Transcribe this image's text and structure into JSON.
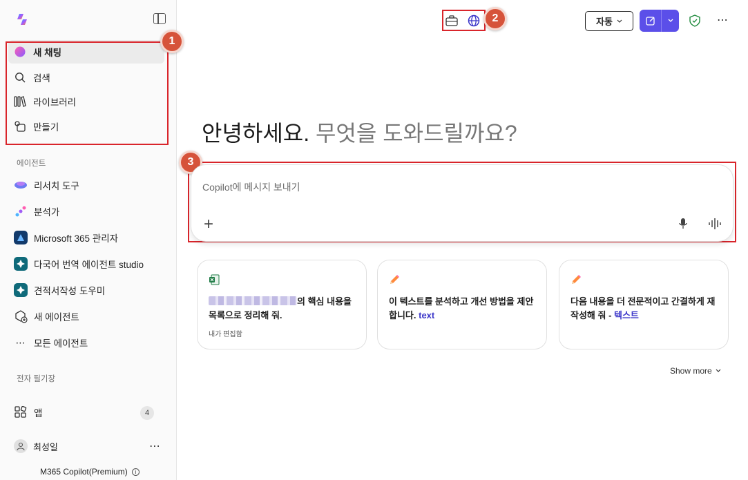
{
  "sidebar": {
    "nav": [
      {
        "label": "새 채팅",
        "icon": "copilot-chat-icon"
      },
      {
        "label": "검색",
        "icon": "search-icon"
      },
      {
        "label": "라이브러리",
        "icon": "library-icon"
      },
      {
        "label": "만들기",
        "icon": "create-icon"
      }
    ],
    "agents_label": "에이전트",
    "agents": [
      {
        "label": "리서치 도구",
        "icon": "researcher-icon"
      },
      {
        "label": "분석가",
        "icon": "analyst-icon"
      },
      {
        "label": "Microsoft 365 관리자",
        "icon": "m365-admin-icon"
      },
      {
        "label": "다국어 번역 에이전트 studio",
        "icon": "translate-agent-icon"
      },
      {
        "label": "견적서작성 도우미",
        "icon": "quote-agent-icon"
      },
      {
        "label": "새 에이전트",
        "icon": "new-agent-icon"
      },
      {
        "label": "모든 에이전트",
        "icon": "more-dots-icon"
      }
    ],
    "notebook_label": "전자 필기장",
    "apps_label": "앱",
    "apps_count": "4",
    "user_name": "최성일",
    "plan": "M365 Copilot(Premium)"
  },
  "annotations": [
    "1",
    "2",
    "3"
  ],
  "topbar": {
    "mode_label": "자동"
  },
  "main": {
    "greeting_1": "안녕하세요.",
    "greeting_2": "무엇을 도와드릴까요?",
    "composer_placeholder": "Copilot에 메시지 보내기",
    "cards": [
      {
        "pre": "",
        "text": "의 핵심 내용을 목록으로 정리해 줘.",
        "accent": "",
        "sub": "내가 편집함",
        "icon": "excel-icon"
      },
      {
        "pre": "",
        "text": "이 텍스트를 분석하고 개선 방법을 제안합니다. ",
        "accent": "text",
        "sub": "",
        "icon": "pencil-icon"
      },
      {
        "pre": "",
        "text": "다음 내용을 더 전문적이고 간결하게 재작성해 줘 - ",
        "accent": "텍스트",
        "sub": "",
        "icon": "pencil-icon"
      }
    ],
    "show_more": "Show more"
  },
  "colors": {
    "accent": "#5b4fe9",
    "annotation_red": "#d9252b",
    "annotation_circle": "#d6533a"
  }
}
